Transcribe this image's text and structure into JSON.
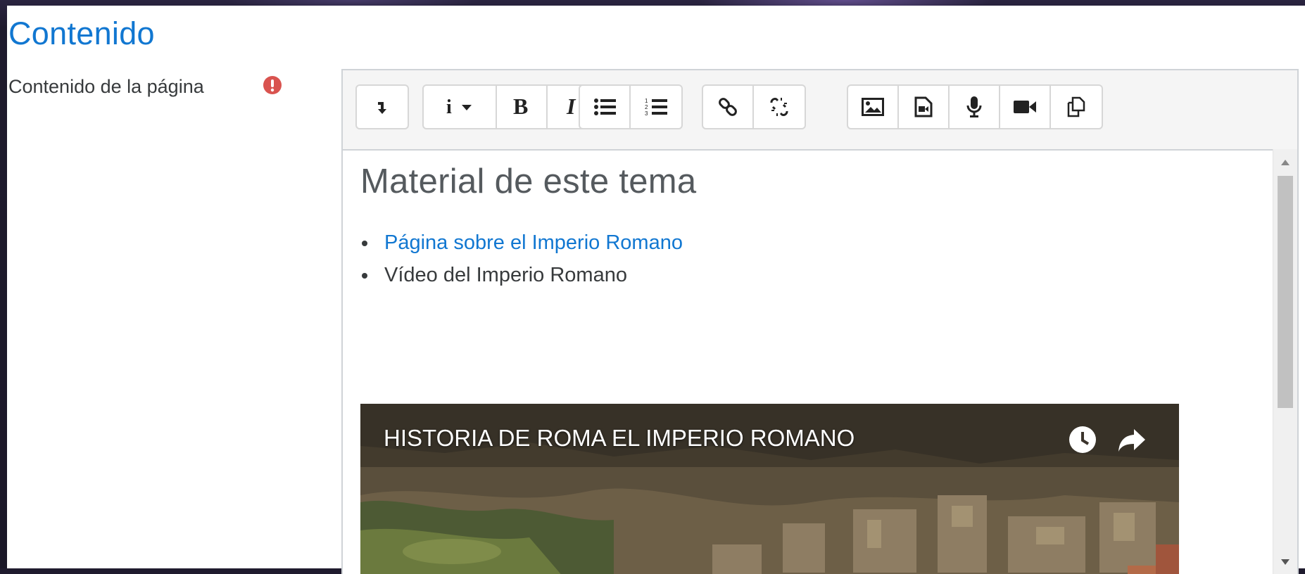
{
  "section": {
    "title": "Contenido"
  },
  "field": {
    "label": "Contenido de la página",
    "required_icon": "exclamation-circle-icon",
    "required_color": "#d9534f"
  },
  "toolbar": {
    "groups": [
      {
        "buttons": [
          "collapse-icon"
        ]
      },
      {
        "buttons": [
          "info-style-icon",
          "bold-icon",
          "italic-icon"
        ]
      },
      {
        "buttons": [
          "unordered-list-icon",
          "ordered-list-icon"
        ]
      },
      {
        "buttons": [
          "link-icon",
          "unlink-icon"
        ]
      },
      {
        "buttons": [
          "image-icon",
          "media-icon",
          "record-audio-icon",
          "record-video-icon",
          "manage-files-icon"
        ]
      }
    ]
  },
  "content": {
    "heading": "Material de este tema",
    "items": [
      {
        "text": "Página sobre el Imperio Romano",
        "is_link": true
      },
      {
        "text": "Vídeo del Imperio Romano",
        "is_link": false
      }
    ],
    "video": {
      "title": "HISTORIA DE ROMA EL IMPERIO ROMANO",
      "icons": [
        "watch-later-icon",
        "share-icon"
      ]
    }
  },
  "colors": {
    "accent": "#1177d1",
    "text": "#373a3c",
    "toolbar_bg": "#f5f5f5"
  }
}
